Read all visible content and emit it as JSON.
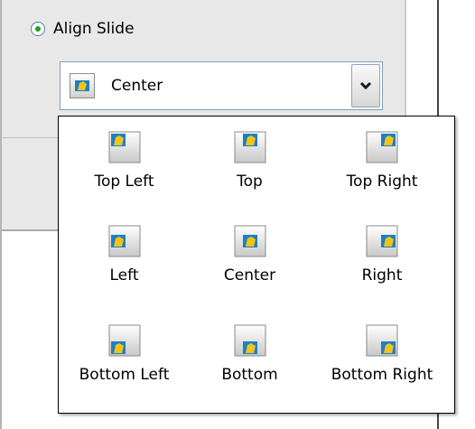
{
  "align_slide": {
    "label": "Align Slide",
    "selected": true
  },
  "combo": {
    "value": "Center",
    "icon": "slide-align-center-icon"
  },
  "options": [
    {
      "label": "Top Left",
      "icon": "align-top-left-icon"
    },
    {
      "label": "Top",
      "icon": "align-top-icon"
    },
    {
      "label": "Top Right",
      "icon": "align-top-right-icon"
    },
    {
      "label": "Left",
      "icon": "align-left-icon"
    },
    {
      "label": "Center",
      "icon": "align-center-icon"
    },
    {
      "label": "Right",
      "icon": "align-right-icon"
    },
    {
      "label": "Bottom Left",
      "icon": "align-bottom-left-icon"
    },
    {
      "label": "Bottom",
      "icon": "align-bottom-icon"
    },
    {
      "label": "Bottom Right",
      "icon": "align-bottom-right-icon"
    }
  ],
  "colors": {
    "radio_dot": "#21a121",
    "icon_blue": "#1e7fc4",
    "icon_yellow": "#f2c416"
  }
}
